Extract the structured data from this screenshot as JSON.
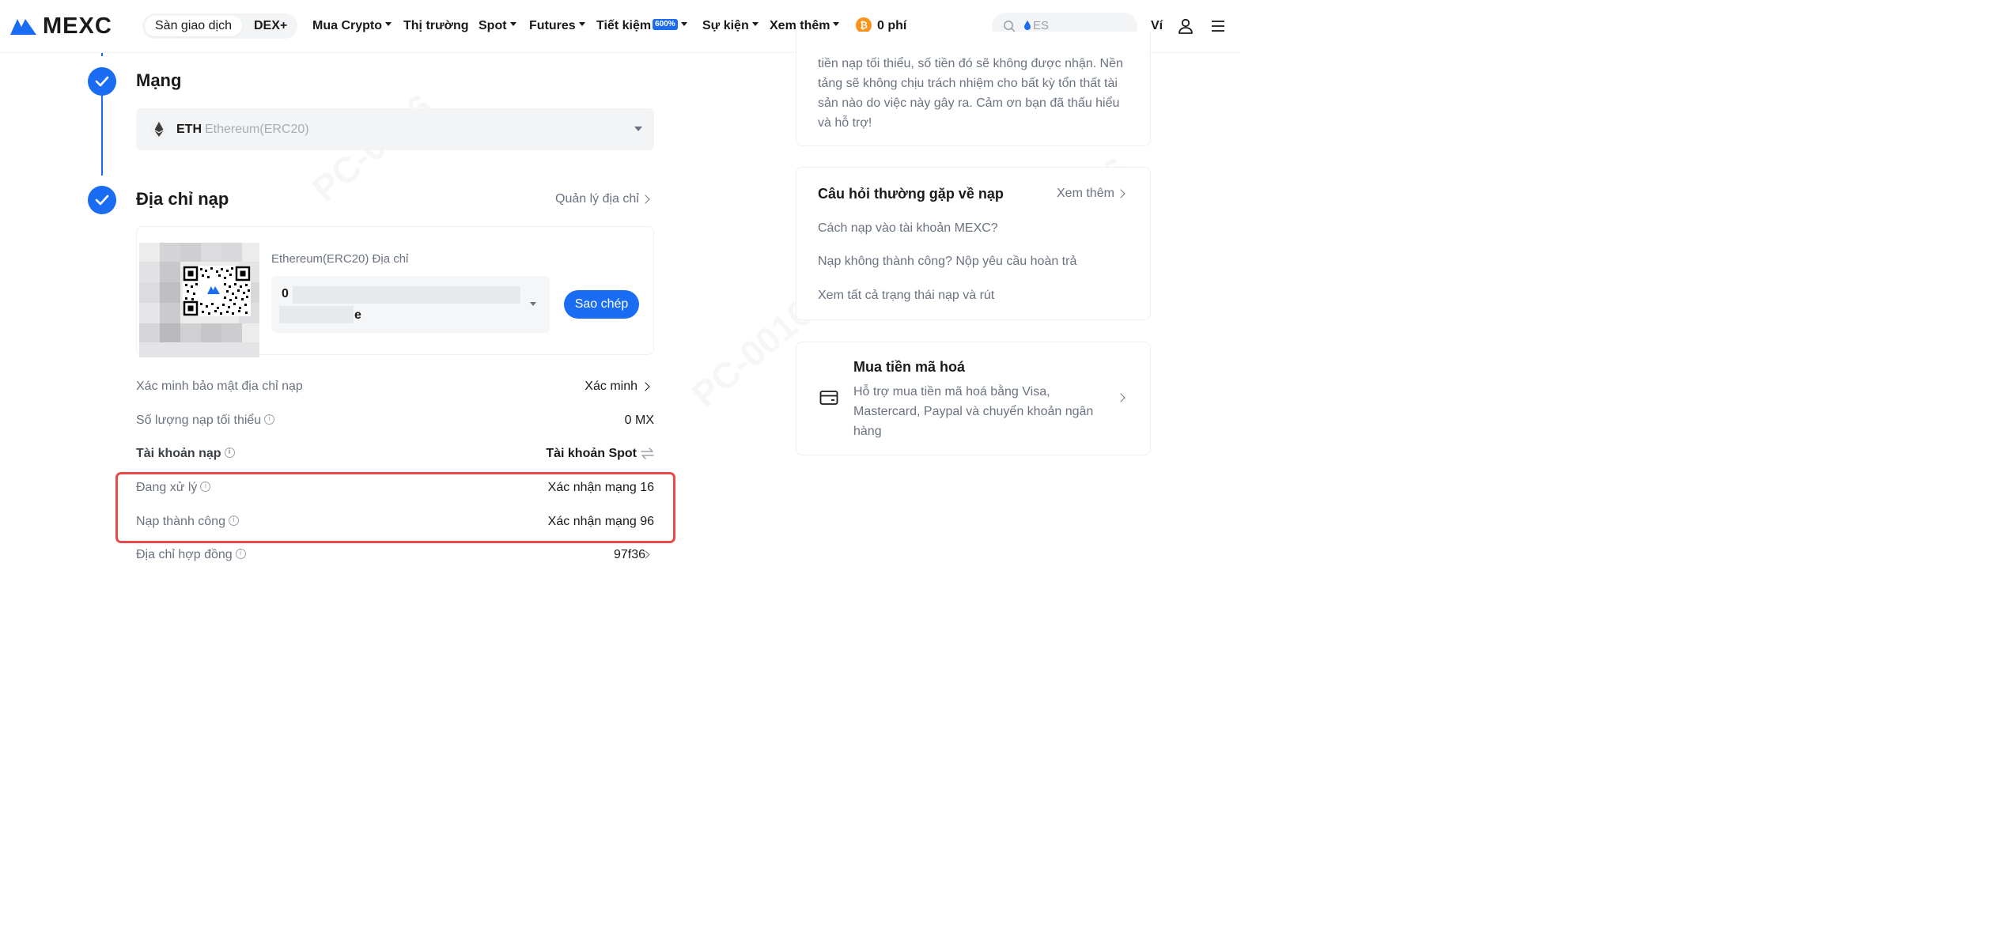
{
  "nav": {
    "brand": "MEXC",
    "segment_exchange": "Sàn giao dịch",
    "segment_dex": "DEX+",
    "items": [
      {
        "label": "Mua Crypto",
        "dropdown": true
      },
      {
        "label": "Thị trường",
        "dropdown": false
      },
      {
        "label": "Spot",
        "dropdown": true
      },
      {
        "label": "Futures",
        "dropdown": true
      },
      {
        "label": "Tiết kiệm",
        "dropdown": true,
        "badge": "600%"
      },
      {
        "label": "Sự kiện",
        "dropdown": true
      },
      {
        "label": "Xem thêm",
        "dropdown": true
      }
    ],
    "zero_fee": "0 phí",
    "search_placeholder": "ES",
    "wallet": "Ví"
  },
  "steps": {
    "network": {
      "title": "Mạng",
      "selected_symbol": "ETH",
      "selected_name": "Ethereum(ERC20)"
    },
    "deposit_address": {
      "title": "Địa chỉ nạp",
      "manage_link": "Quản lý địa chỉ",
      "address_label": "Ethereum(ERC20) Địa chỉ",
      "address_start": "0",
      "address_end": "e",
      "copy_button": "Sao chép"
    }
  },
  "details": [
    {
      "label": "Xác minh bảo mật địa chỉ nạp",
      "value": "Xác minh",
      "info": false,
      "link": true
    },
    {
      "label": "Số lượng nạp tối thiểu",
      "value": "0 MX",
      "info": true
    },
    {
      "label": "Tài khoản nạp",
      "value": "Tài khoản Spot",
      "info": true,
      "swap": true
    },
    {
      "label": "Đang xử lý",
      "value": "Xác nhận mạng 16",
      "info": true
    },
    {
      "label": "Nạp thành công",
      "value": "Xác nhận mạng 96",
      "info": true
    },
    {
      "label": "Địa chỉ hợp đồng",
      "value": "97f36",
      "info": true,
      "link": true
    }
  ],
  "notice": {
    "text": "tiền nạp tối thiểu, số tiền đó sẽ không được nhận. Nền tảng sẽ không chịu trách nhiệm cho bất kỳ tổn thất tài sản nào do việc này gây ra. Cảm ơn bạn đã thấu hiểu và hỗ trợ!"
  },
  "faq": {
    "title": "Câu hỏi thường gặp về nạp",
    "more": "Xem thêm",
    "links": [
      "Cách nạp vào tài khoản MEXC?",
      "Nạp không thành công? Nộp yêu cầu hoàn trả",
      "Xem tất cả trạng thái nạp và rút"
    ]
  },
  "buy": {
    "title": "Mua tiền mã hoá",
    "description": "Hỗ trợ mua tiền mã hoá bằng Visa, Mastercard, Paypal và chuyển khoản ngân hàng"
  },
  "colors": {
    "accent": "#1a6cf2",
    "highlight_border": "#e84a4a"
  }
}
